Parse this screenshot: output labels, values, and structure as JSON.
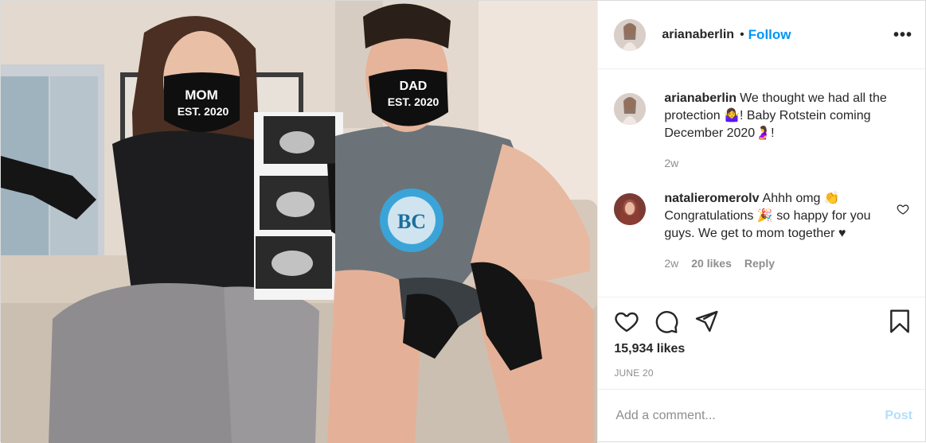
{
  "post": {
    "photo_alt": "",
    "mask_left": [
      "MOM",
      "EST. 2020"
    ],
    "mask_right": [
      "DAD",
      "EST. 2020"
    ],
    "shirt_text": "BC"
  },
  "header": {
    "username": "arianaberlin",
    "separator": "•",
    "follow_label": "Follow",
    "more_label": "•••"
  },
  "caption": {
    "username": "arianaberlin",
    "text": "We thought we had all the protection 🤷‍♀️! Baby Rotstein coming December 2020🤰!",
    "time": "2w"
  },
  "comments": [
    {
      "username": "natalieromerolv",
      "text": "Ahhh omg 👏 Congratulations 🎉 so happy for you guys. We get to mom together ♥",
      "time": "2w",
      "likes": "20 likes",
      "reply_label": "Reply"
    }
  ],
  "actions": {
    "likes": "15,934 likes",
    "date": "JUNE 20"
  },
  "add_comment": {
    "placeholder": "Add a comment...",
    "post_label": "Post"
  },
  "colors": {
    "accent": "#0095f6",
    "post_disabled": "#b2dffc",
    "muted": "#8e8e8e",
    "text": "#262626"
  }
}
